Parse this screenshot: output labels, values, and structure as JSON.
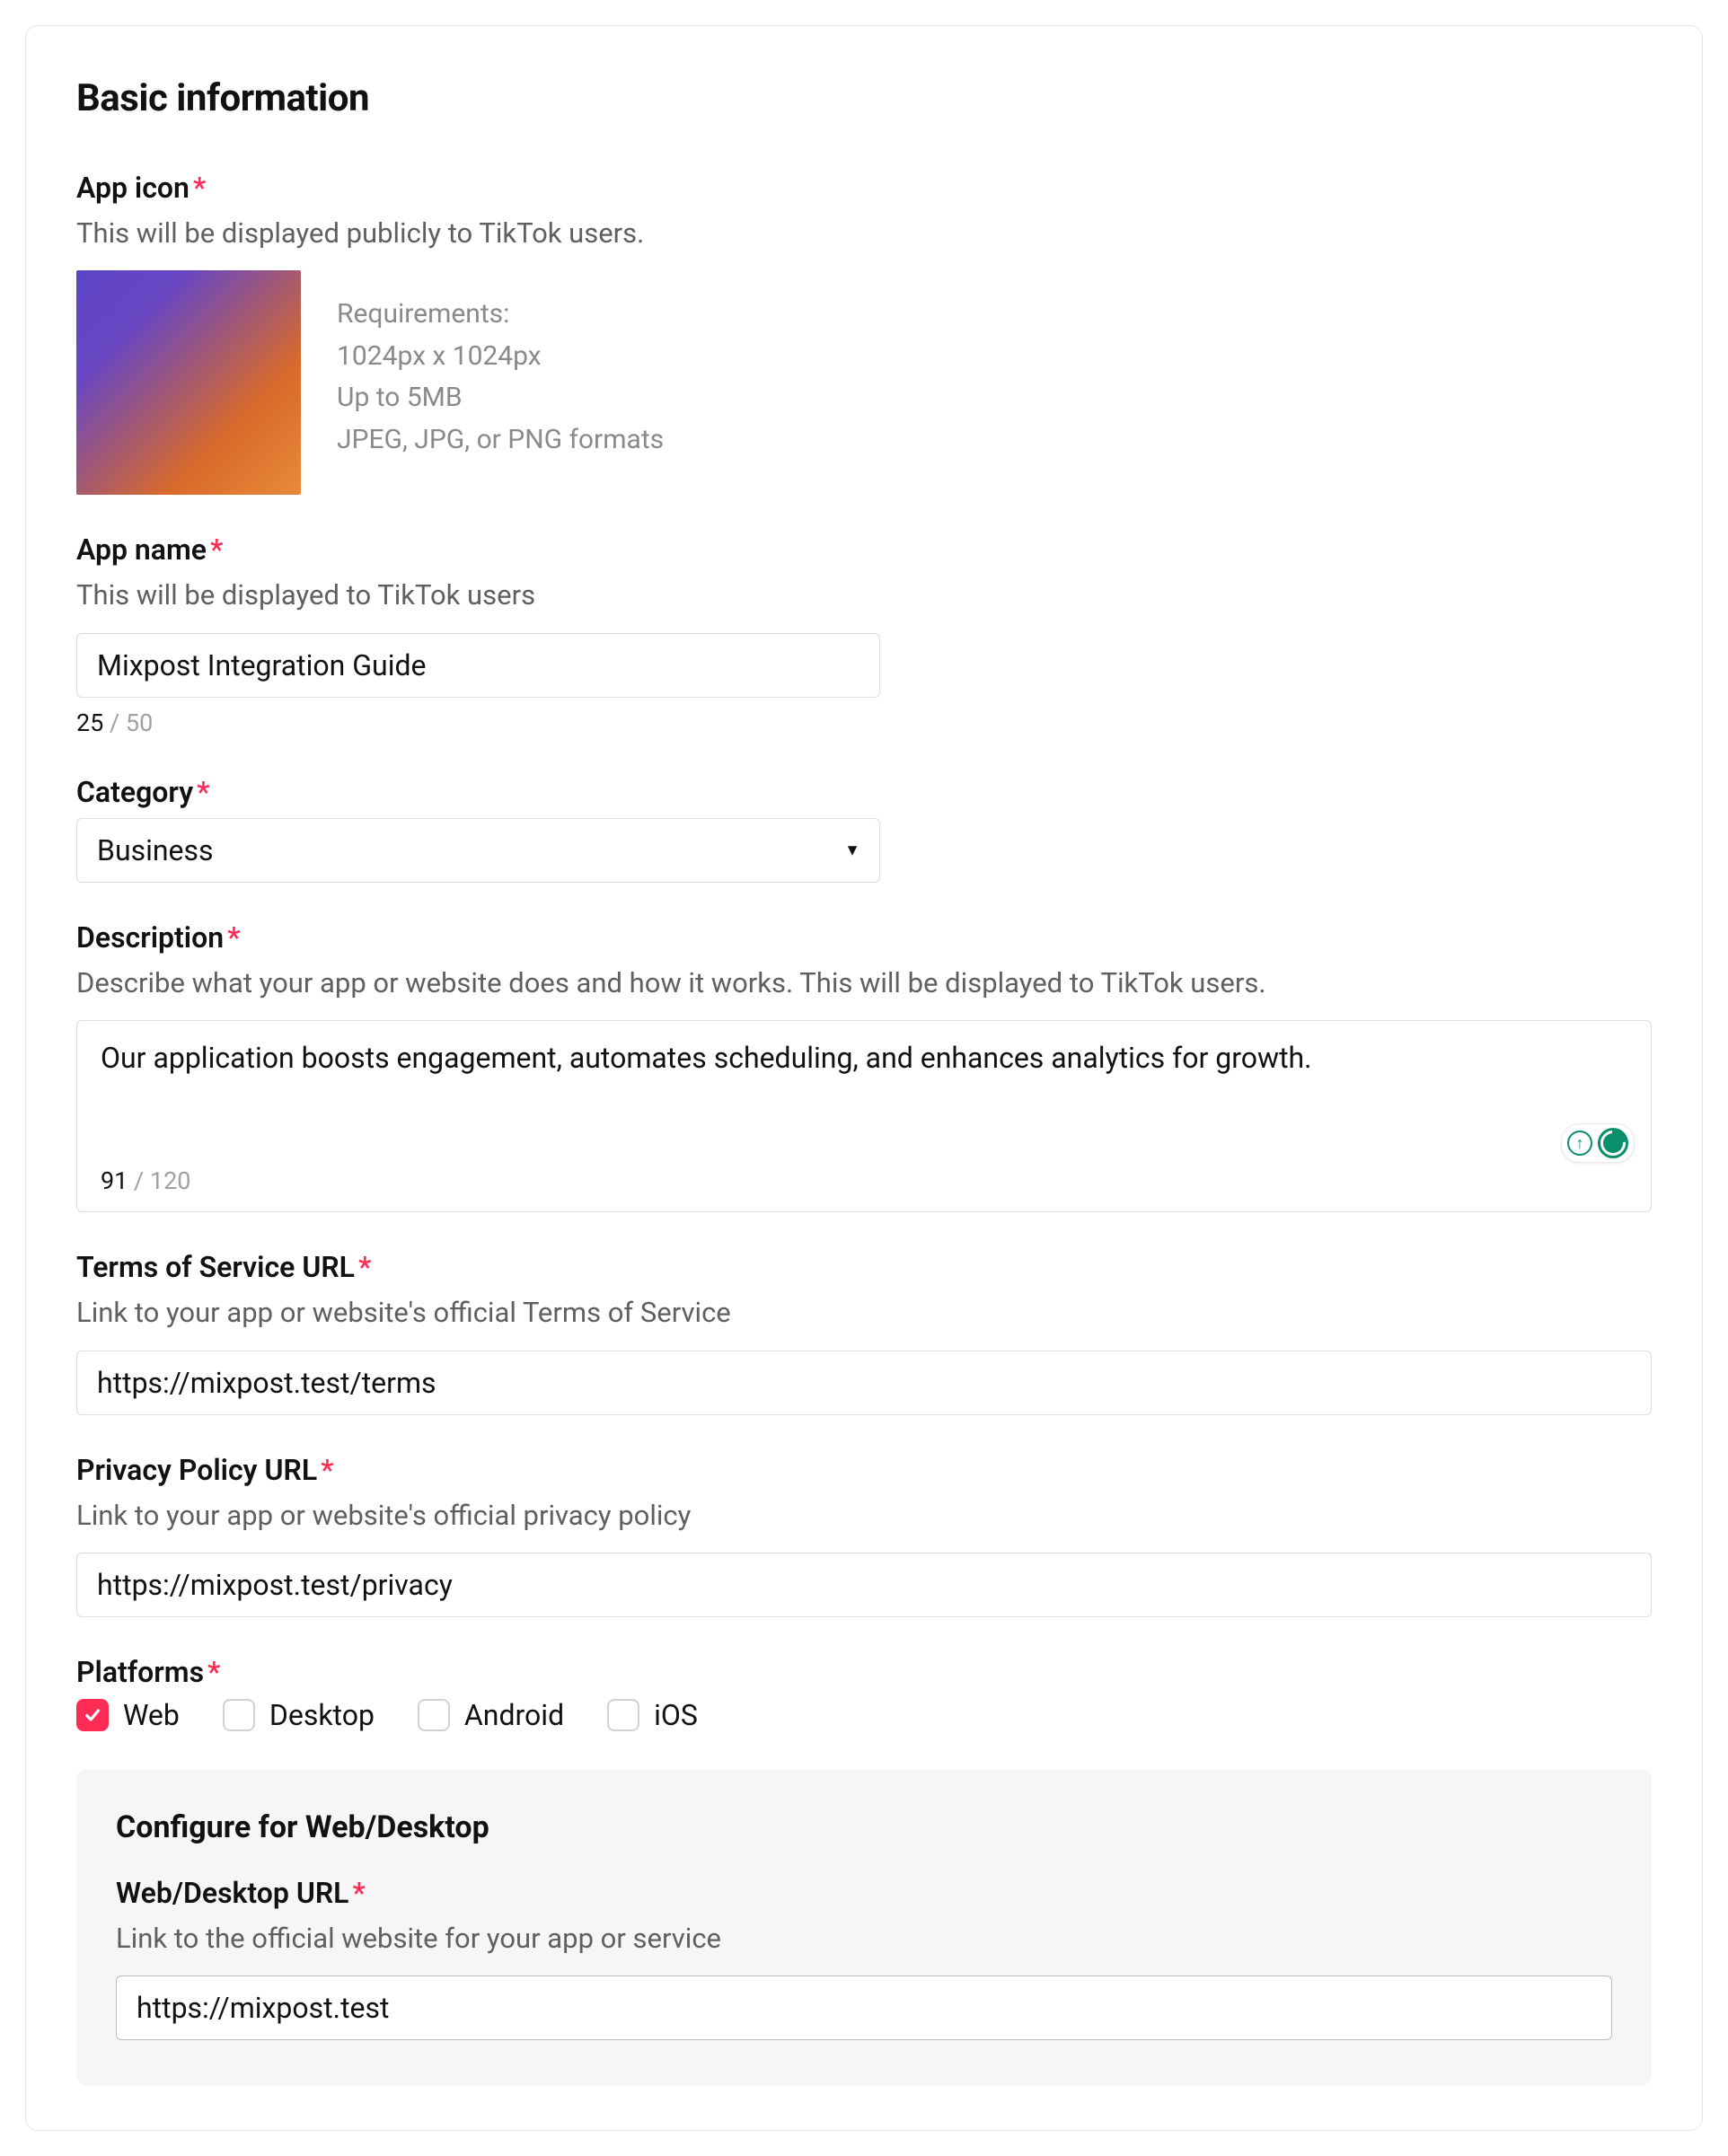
{
  "section_title": "Basic information",
  "app_icon": {
    "label": "App icon",
    "helper": "This will be displayed publicly to TikTok users.",
    "req_header": "Requirements:",
    "req_dims": "1024px x 1024px",
    "req_size": "Up to 5MB",
    "req_formats": "JPEG, JPG, or PNG formats"
  },
  "app_name": {
    "label": "App name",
    "helper": "This will be displayed to TikTok users",
    "value": "Mixpost Integration Guide",
    "count": "25",
    "max": "50"
  },
  "category": {
    "label": "Category",
    "value": "Business"
  },
  "description": {
    "label": "Description",
    "helper": "Describe what your app or website does and how it works. This will be displayed to TikTok users.",
    "value": "Our application boosts engagement, automates scheduling, and enhances analytics for growth.",
    "count": "91",
    "max": "120"
  },
  "tos_url": {
    "label": "Terms of Service URL",
    "helper": "Link to your app or website's official Terms of Service",
    "value": "https://mixpost.test/terms"
  },
  "privacy_url": {
    "label": "Privacy Policy URL",
    "helper": "Link to your app or website's official privacy policy",
    "value": "https://mixpost.test/privacy"
  },
  "platforms": {
    "label": "Platforms",
    "options": [
      {
        "label": "Web",
        "checked": true
      },
      {
        "label": "Desktop",
        "checked": false
      },
      {
        "label": "Android",
        "checked": false
      },
      {
        "label": "iOS",
        "checked": false
      }
    ]
  },
  "configure": {
    "heading": "Configure for Web/Desktop",
    "url_label": "Web/Desktop URL",
    "url_helper": "Link to the official website for your app or service",
    "url_value": "https://mixpost.test"
  }
}
